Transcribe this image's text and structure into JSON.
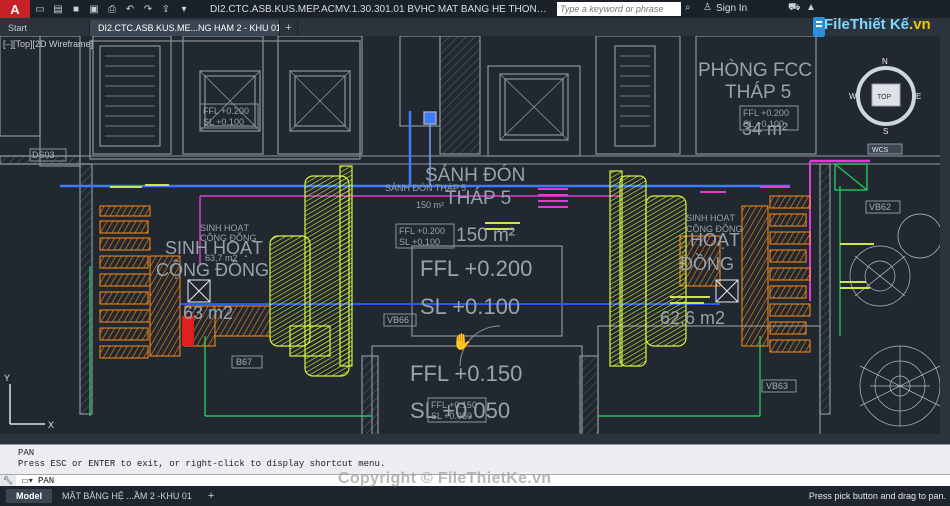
{
  "app": {
    "logo_letter": "A",
    "title": "DI2.CTC.ASB.KUS.MEP.ACMV.1.30.301.01 BVHC MAT BANG HE THONG ĐHKK VA TH...",
    "search_placeholder": "Type a keyword or phrase",
    "signin_label": "Sign In"
  },
  "tabs": [
    {
      "label": "Start"
    },
    {
      "label": "DI2.CTC.ASB.KUS.ME...NG HAM 2 - KHU 01*"
    }
  ],
  "viewport": {
    "view_label": "[–][Top][2D Wireframe]"
  },
  "drawing": {
    "room_labels": {
      "phong_fcc": "PHÒNG FCC",
      "thap5_a": "THÁP 5",
      "area_34": "34 m²",
      "sanh_don": "SẢNH ĐÓN",
      "thap5_b": "THÁP 5",
      "area_150": "150 m²",
      "ffl_0200": "FFL +0.200",
      "sl_0100": "SL  +0.100",
      "ffl_0150": "FFL +0.150",
      "sl_0050": "SL  +0.050",
      "sinh_hoat_left": "SINH HOẠT",
      "cong_dong_left": "CỘNG ĐỒNG",
      "area_63": "63 m2",
      "sinh_hoat_small": "SINH HOẠT",
      "cong_dong_small": "CỘNG ĐỒNG",
      "area_637": "63,7 m2",
      "sinh_hoat_right": "SINH HOẠT",
      "cong_dong_right": "CỘNG ĐỒNG",
      "area_626": "62,6 m2",
      "ffl_small_1": "FFL +0.200",
      "sl_small_1": "SL  +0.100",
      "ffl_small_2": "FFL +0.200",
      "sl_small_2": "SL  +0.100",
      "ffl_small_3": "FFL +0.200",
      "sl_small_3": "SL  +0.100",
      "ffl_small_4": "FFL +0.150",
      "sl_small_4": "SL  +0.050",
      "sanh_don_small": "SẢNH ĐÓN THÁP 5",
      "area_150_small": "150 m²",
      "ds": "DS03",
      "vb66": "VB66",
      "vb63": "VB63",
      "vb62": "VB62",
      "b67": "B67",
      "wcs": "WCS"
    },
    "compass": {
      "n": "N",
      "s": "S",
      "e": "E",
      "w": "W",
      "top": "TOP"
    },
    "ucs": {
      "y": "Y",
      "x": "X"
    }
  },
  "command": {
    "history": [
      "PAN",
      "Press ESC or ENTER to exit, or right-click to display shortcut menu."
    ],
    "input": "PAN"
  },
  "layouts": [
    {
      "label": "Model"
    },
    {
      "label": "MẶT BẰNG HỆ ...ẦM 2 -KHU 01"
    }
  ],
  "status_hint": "Press pick button and drag to pan.",
  "watermark": "Copyright © FileThietKe.vn",
  "brand": {
    "name_part1": "File",
    "name_part2": "Thiết Kế",
    "suffix": ".vn"
  },
  "colors": {
    "background": "#212830",
    "duct_orange": "#ff8c1a",
    "duct_yellow": "#d8f53a",
    "pipe_blue": "#2a59ff",
    "pipe_magenta": "#e23bd8",
    "pipe_green": "#22c55e",
    "app_red": "#c62127"
  }
}
